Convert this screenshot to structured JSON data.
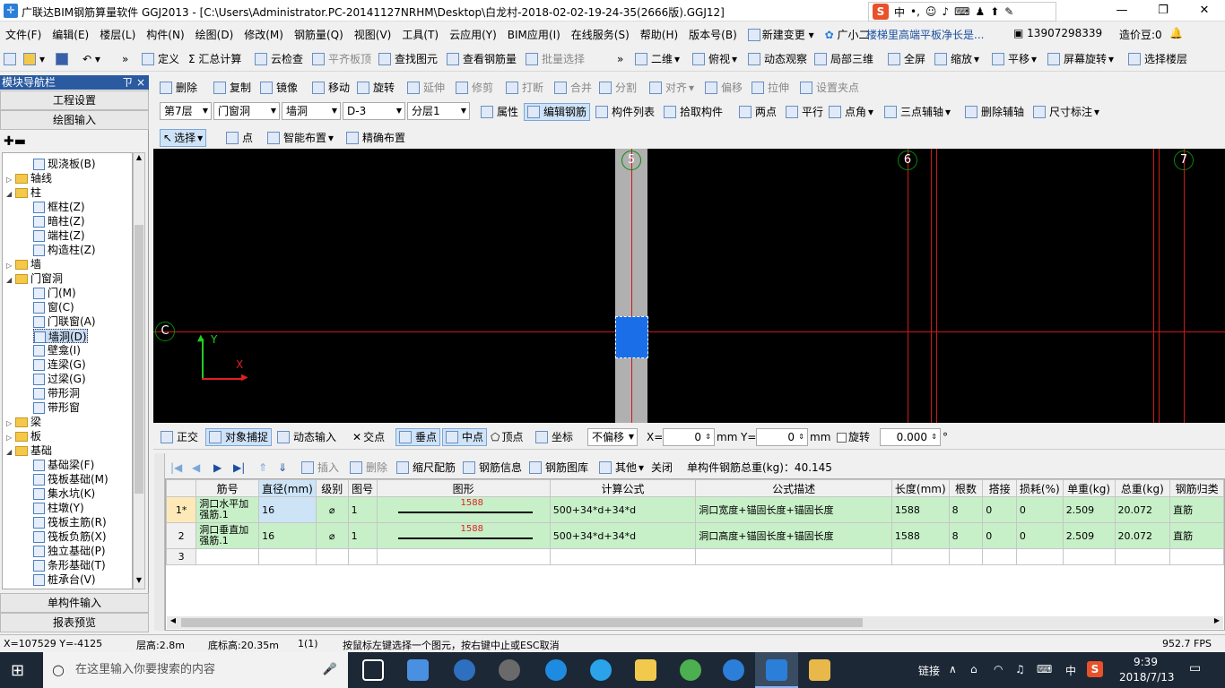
{
  "app": {
    "title": "广联达BIM钢筋算量软件 GGJ2013 - [C:\\Users\\Administrator.PC-20141127NRHM\\Desktop\\白龙村-2018-02-02-19-24-35(2666版).GGJ12]"
  },
  "ime": {
    "lang": "中",
    "dot": "•,"
  },
  "menu": [
    "文件(F)",
    "编辑(E)",
    "楼层(L)",
    "构件(N)",
    "绘图(D)",
    "修改(M)",
    "钢筋量(Q)",
    "视图(V)",
    "工具(T)",
    "云应用(Y)",
    "BIM应用(I)",
    "在线服务(S)",
    "帮助(H)",
    "版本号(B)",
    "新建变更",
    "广小二"
  ],
  "menu_right": {
    "notice": "楼梯里高端平板净长是...",
    "phone": "13907298339",
    "credit": "造价豆:0"
  },
  "toolbar1": [
    "定义",
    "Σ 汇总计算",
    "云检查",
    "平齐板顶",
    "查找图元",
    "查看钢筋量",
    "批量选择",
    "二维",
    "俯视",
    "动态观察",
    "局部三维",
    "全屏",
    "缩放",
    "平移",
    "屏幕旋转",
    "选择楼层"
  ],
  "toolbar2": [
    "删除",
    "复制",
    "镜像",
    "移动",
    "旋转",
    "延伸",
    "修剪",
    "打断",
    "合并",
    "分割",
    "对齐",
    "偏移",
    "拉伸",
    "设置夹点"
  ],
  "toolbar3": {
    "floor": "第7层",
    "category": "门窗洞",
    "type": "墙洞",
    "component": "D-3",
    "layer": "分层1",
    "items": [
      "属性",
      "编辑钢筋",
      "构件列表",
      "拾取构件",
      "两点",
      "平行",
      "点角",
      "三点辅轴",
      "删除辅轴",
      "尺寸标注"
    ]
  },
  "toolbar4": [
    "选择",
    "点",
    "智能布置",
    "精确布置"
  ],
  "nav": {
    "header": "模块导航栏",
    "pin": "ㄗ",
    "close": "×",
    "project": "工程设置",
    "draw": "绘图输入",
    "single": "单构件输入",
    "report": "报表预览"
  },
  "tree": [
    {
      "t": "现浇板(B)",
      "lvl": 2,
      "kind": "leaf"
    },
    {
      "t": "轴线",
      "lvl": 0,
      "kind": "folder",
      "exp": "▷"
    },
    {
      "t": "柱",
      "lvl": 0,
      "kind": "folder",
      "exp": "◢"
    },
    {
      "t": "框柱(Z)",
      "lvl": 2,
      "kind": "leaf"
    },
    {
      "t": "暗柱(Z)",
      "lvl": 2,
      "kind": "leaf"
    },
    {
      "t": "端柱(Z)",
      "lvl": 2,
      "kind": "leaf"
    },
    {
      "t": "构造柱(Z)",
      "lvl": 2,
      "kind": "leaf"
    },
    {
      "t": "墙",
      "lvl": 0,
      "kind": "folder",
      "exp": "▷"
    },
    {
      "t": "门窗洞",
      "lvl": 0,
      "kind": "folder",
      "exp": "◢"
    },
    {
      "t": "门(M)",
      "lvl": 2,
      "kind": "leaf"
    },
    {
      "t": "窗(C)",
      "lvl": 2,
      "kind": "leaf"
    },
    {
      "t": "门联窗(A)",
      "lvl": 2,
      "kind": "leaf"
    },
    {
      "t": "墙洞(D)",
      "lvl": 2,
      "kind": "leaf",
      "sel": true
    },
    {
      "t": "壁龛(I)",
      "lvl": 2,
      "kind": "leaf"
    },
    {
      "t": "连梁(G)",
      "lvl": 2,
      "kind": "leaf"
    },
    {
      "t": "过梁(G)",
      "lvl": 2,
      "kind": "leaf"
    },
    {
      "t": "带形洞",
      "lvl": 2,
      "kind": "leaf"
    },
    {
      "t": "带形窗",
      "lvl": 2,
      "kind": "leaf"
    },
    {
      "t": "梁",
      "lvl": 0,
      "kind": "folder",
      "exp": "▷"
    },
    {
      "t": "板",
      "lvl": 0,
      "kind": "folder",
      "exp": "▷"
    },
    {
      "t": "基础",
      "lvl": 0,
      "kind": "folder",
      "exp": "◢"
    },
    {
      "t": "基础梁(F)",
      "lvl": 2,
      "kind": "leaf"
    },
    {
      "t": "筏板基础(M)",
      "lvl": 2,
      "kind": "leaf"
    },
    {
      "t": "集水坑(K)",
      "lvl": 2,
      "kind": "leaf"
    },
    {
      "t": "柱墩(Y)",
      "lvl": 2,
      "kind": "leaf"
    },
    {
      "t": "筏板主筋(R)",
      "lvl": 2,
      "kind": "leaf"
    },
    {
      "t": "筏板负筋(X)",
      "lvl": 2,
      "kind": "leaf"
    },
    {
      "t": "独立基础(P)",
      "lvl": 2,
      "kind": "leaf"
    },
    {
      "t": "条形基础(T)",
      "lvl": 2,
      "kind": "leaf"
    },
    {
      "t": "桩承台(V)",
      "lvl": 2,
      "kind": "leaf"
    }
  ],
  "canvas": {
    "axes": [
      "5",
      "6",
      "7",
      "C"
    ],
    "y_label": "Y",
    "x_label": "X"
  },
  "snap": {
    "items": [
      "正交",
      "对象捕捉",
      "动态输入",
      "交点",
      "垂点",
      "中点",
      "顶点",
      "坐标"
    ],
    "offset": "不偏移",
    "x_label": "X=",
    "x_value": "0",
    "y_label": "Y=",
    "y_value": "0",
    "unit": "mm",
    "rotate_label": "旋转",
    "rotate_value": "0.000",
    "deg": "°"
  },
  "rebar": {
    "items": [
      "插入",
      "删除",
      "缩尺配筋",
      "钢筋信息",
      "钢筋图库",
      "其他",
      "关闭"
    ],
    "total": "单构件钢筋总重(kg)：40.145"
  },
  "table": {
    "headers": [
      "",
      "筋号",
      "直径(mm)",
      "级别",
      "图号",
      "图形",
      "计算公式",
      "公式描述",
      "长度(mm)",
      "根数",
      "搭接",
      "损耗(%)",
      "单重(kg)",
      "总重(kg)",
      "钢筋归类"
    ],
    "rows": [
      {
        "no": "1*",
        "name": "洞口水平加强筋.1",
        "dia": "16",
        "grade": "⌀",
        "fig": "1",
        "shape": "1588",
        "formula": "500+34*d+34*d",
        "desc": "洞口宽度+锚固长度+锚固长度",
        "len": "1588",
        "count": "8",
        "lap": "0",
        "loss": "0",
        "unit_w": "2.509",
        "total_w": "20.072",
        "cat": "直筋"
      },
      {
        "no": "2",
        "name": "洞口垂直加强筋.1",
        "dia": "16",
        "grade": "⌀",
        "fig": "1",
        "shape": "1588",
        "formula": "500+34*d+34*d",
        "desc": "洞口高度+锚固长度+锚固长度",
        "len": "1588",
        "count": "8",
        "lap": "0",
        "loss": "0",
        "unit_w": "2.509",
        "total_w": "20.072",
        "cat": "直筋"
      },
      {
        "no": "3",
        "name": "",
        "dia": "",
        "grade": "",
        "fig": "",
        "shape": "",
        "formula": "",
        "desc": "",
        "len": "",
        "count": "",
        "lap": "",
        "loss": "",
        "unit_w": "",
        "total_w": "",
        "cat": ""
      }
    ]
  },
  "status": {
    "coords": "X=107529 Y=-4125",
    "floor_h": "层高:2.8m",
    "bottom_h": "底标高:20.35m",
    "page": "1(1)",
    "hint": "按鼠标左键选择一个图元，按右键中止或ESC取消",
    "fps": "952.7 FPS"
  },
  "taskbar": {
    "search": "在这里输入你要搜索的内容",
    "link": "链接",
    "lang": "中",
    "time": "9:39",
    "date": "2018/7/13"
  },
  "colors": {
    "canvas": "#000000",
    "axis": "#d01818",
    "selected": "#1a6fe8",
    "wall": "#b0b0b0",
    "greenrow": "#c8f0c8"
  }
}
